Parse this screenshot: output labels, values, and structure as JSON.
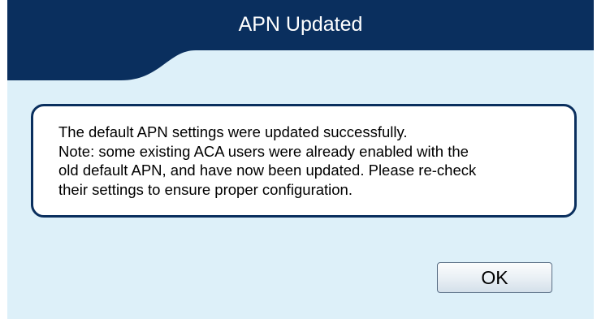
{
  "dialog": {
    "title": "APN Updated",
    "message_lines": [
      "The default APN settings were updated successfully.",
      "Note: some existing ACA users were already enabled with the",
      "old default APN, and have now been updated. Please re-check",
      "their settings to ensure proper configuration."
    ],
    "ok_label": "OK"
  },
  "colors": {
    "header": "#0a2f5e",
    "body_background": "#ddf0f9",
    "message_border": "#0a2f5e"
  }
}
